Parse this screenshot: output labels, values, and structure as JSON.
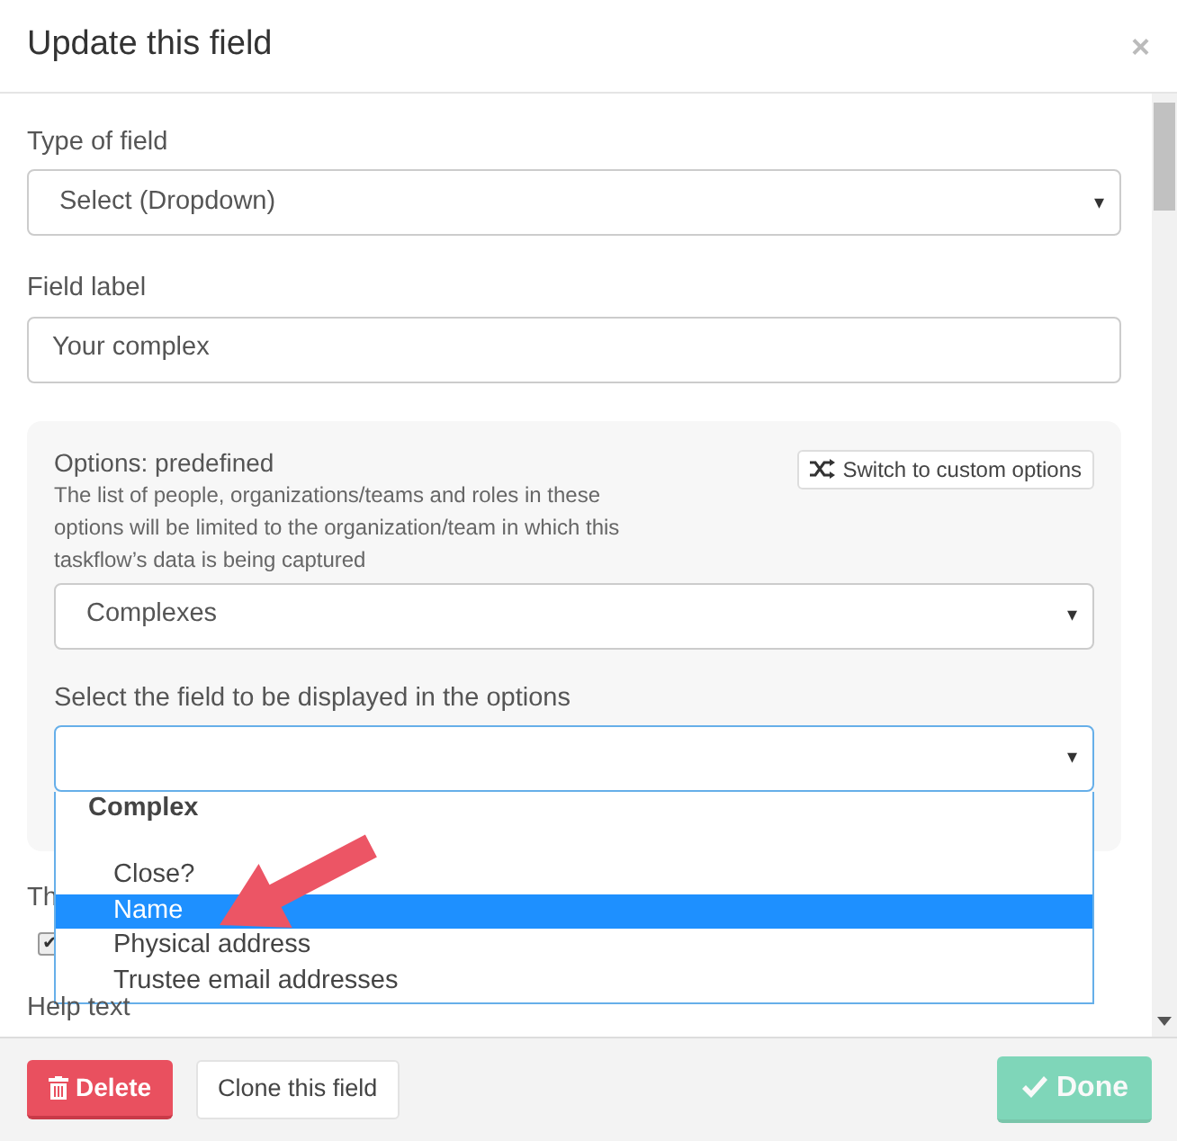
{
  "modal": {
    "title": "Update this field",
    "close": "×"
  },
  "fields": [
    {
      "label": "Type of field",
      "kind": "select",
      "value": "Select (Dropdown)",
      "caret": "▾"
    },
    {
      "label": "Field label",
      "kind": "input",
      "value": "Your complex"
    }
  ],
  "options_panel": {
    "title": "Options: predefined",
    "help": "The list of people, organizations/teams and roles in these options will be limited to the organization/team in which this taskflow’s data is being captured",
    "switch_button": "Switch to custom options",
    "source_select": {
      "value": "Complexes",
      "caret": "▾"
    },
    "display_label": "Select the field to be displayed in the options",
    "display_select": {
      "caret": "▾",
      "expanded": true
    },
    "dropdown": [
      {
        "kind": "group",
        "text": "Complex",
        "selected": false
      },
      {
        "kind": "option",
        "text": "Close?",
        "selected": false
      },
      {
        "kind": "option",
        "text": "Name",
        "selected": true
      },
      {
        "kind": "option",
        "text": "Physical address",
        "selected": false
      },
      {
        "kind": "option",
        "text": "Trustee email addresses",
        "selected": false
      }
    ]
  },
  "behind": {
    "label": "Th",
    "checkbox": {
      "checked": true,
      "mark": "✔"
    },
    "help_label": "Help text"
  },
  "footer": {
    "delete": "Delete",
    "clone": "Clone this field",
    "done": "Done",
    "done_disabled": true
  }
}
